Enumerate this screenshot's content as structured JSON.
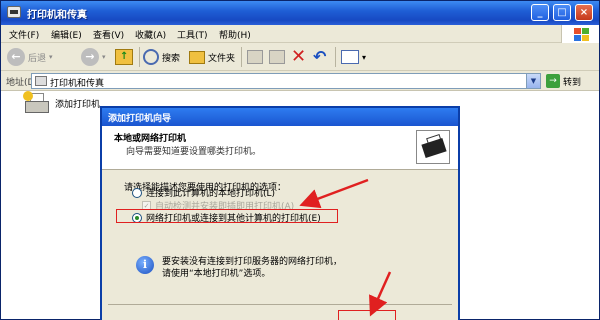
{
  "window": {
    "title": "打印机和传真",
    "min_label": "_",
    "max_label": "□",
    "close_label": "×"
  },
  "menu": [
    "文件(F)",
    "编辑(E)",
    "查看(V)",
    "收藏(A)",
    "工具(T)",
    "帮助(H)"
  ],
  "toolbar": {
    "back_label": "后退",
    "search_label": "搜索",
    "folders_label": "文件夹",
    "view_label": "▾"
  },
  "address": {
    "label": "地址(D)",
    "value": "打印机和传真",
    "go_label": "转到"
  },
  "content": {
    "add_printer_label": "添加打印机"
  },
  "wizard": {
    "title": "添加打印机向导",
    "header_title": "本地或网络打印机",
    "header_subtitle": "向导需要知道要设置哪类打印机。",
    "prompt": "请选择能描述您要使用的打印机的选项：",
    "option_local": "连接到此计算机的本地打印机(L)",
    "option_autodetect": "自动检测并安装即插即用打印机(A)",
    "option_network": "网络打印机或连接到其他计算机的打印机(E)",
    "info_line1": "要安装没有连接到打印服务器的网络打印机，",
    "info_line2": "请使用“本地打印机”选项。"
  },
  "colors": {
    "titlebar": "#1f5fd6",
    "annotation": "#e02020",
    "dialog_bg": "#ece9d8"
  }
}
